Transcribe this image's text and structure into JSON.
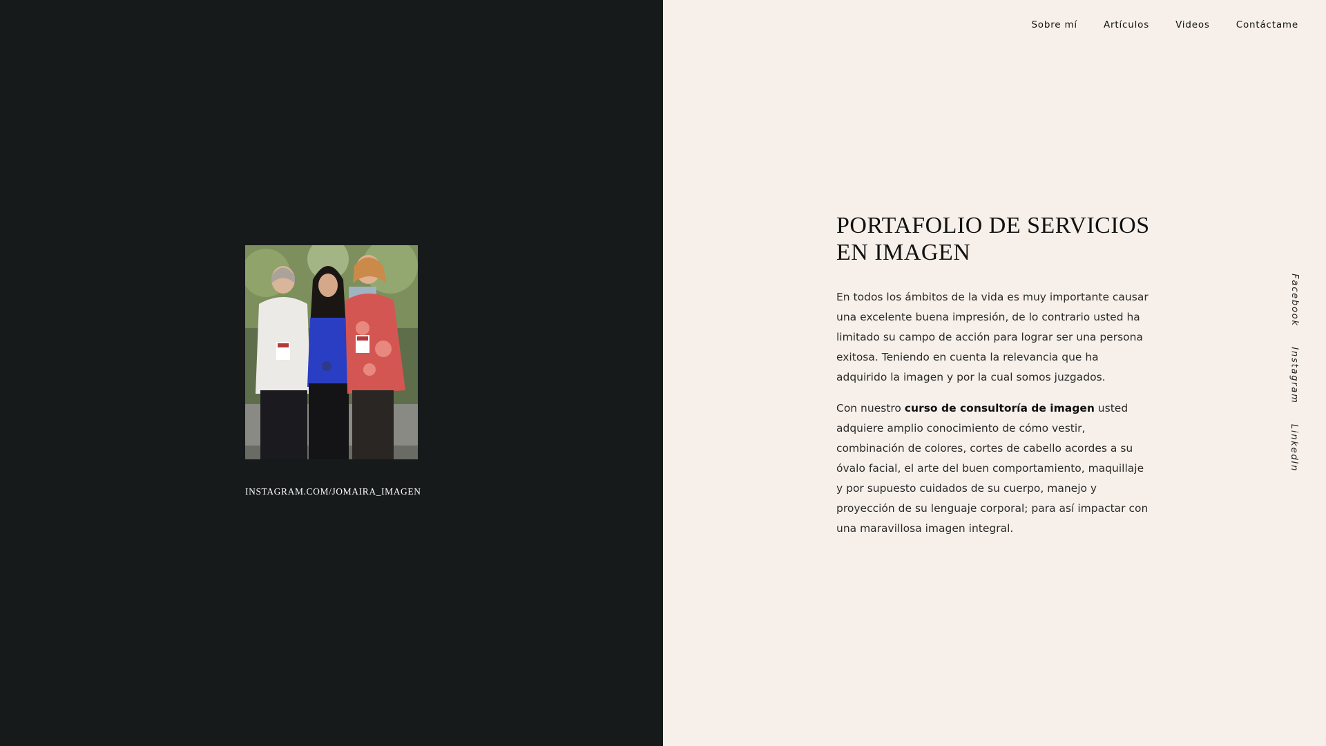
{
  "nav": {
    "items": [
      "Sobre mí",
      "Artículos",
      "Videos",
      "Contáctame"
    ]
  },
  "left": {
    "caption": "INSTAGRAM.COM/JOMAIRA_IMAGEN"
  },
  "content": {
    "title": "PORTAFOLIO DE SERVICIOS EN IMAGEN",
    "paragraph1": "En todos los ámbitos de la vida es muy importante causar una excelente buena impresión, de lo contrario usted ha limitado su campo de acción para lograr ser una persona exitosa. Teniendo en cuenta la relevancia que ha adquirido la imagen y por la cual somos juzgados.",
    "paragraph2_before": "Con nuestro ",
    "paragraph2_bold": "curso de consultoría de imagen",
    "paragraph2_after": " usted adquiere amplio conocimiento de cómo vestir, combinación de colores, cortes de cabello acordes a su óvalo facial, el arte del buen comportamiento, maquillaje y por supuesto cuidados de su cuerpo, manejo y proyección de su lenguaje corporal; para así impactar con una maravillosa imagen integral."
  },
  "social": {
    "facebook": "Facebook",
    "instagram": "Instagram",
    "linkedin": "LinkedIn"
  },
  "colors": {
    "left_background": "#161a1b",
    "right_background": "#f7f0ea",
    "text": "#111111"
  }
}
